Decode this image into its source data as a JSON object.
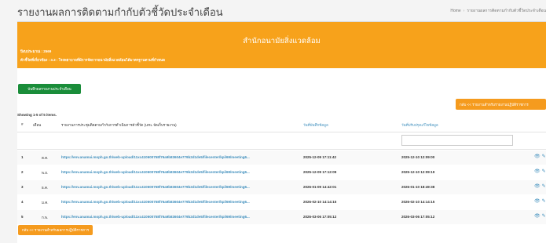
{
  "header": {
    "title": "รายงานผลการติดตามกำกับตัวชี้วัดประจำเดือน",
    "breadcrumb": [
      "Home",
      "รายงานผลการติดตามกำกับตัวชี้วัดประจำเดือน"
    ]
  },
  "banner": {
    "title": "สำนักอนามัยสิ่งแวดล้อม",
    "year_line": "ปีงบประมาณ : 2569",
    "indicator_line": "ตัวชี้วัดที่เกี่ยวข้อง : 3.3 : โรงพยาบาลที่มีการจัดการอนามัยสิ่งแวดล้อมได้มาตรฐานตามที่กำหนด",
    "color": "#f7a21b"
  },
  "buttons": {
    "add": "บันทึกผลรายงานประจำเดือน",
    "back_top": "กลับ << รายงานสำหรับรายงานปฏิบัติราชการ",
    "back_bottom": "กลับ << รายงานสำหรับผลการปฏิบัติราชการ"
  },
  "table": {
    "summary": "Showing 1-5 of 5 items.",
    "columns": [
      "#",
      "เดือน",
      "รายงานการประชุมติดตามกำกับการดำเนินการตัวชี้วัด (URL จัดเก็บรายงาน)",
      "วันที่บันทึกข้อมูล",
      "วันที่ปรับปรุงแก้ไขข้อมูล"
    ],
    "rows": [
      {
        "num": "1",
        "month": "ต.ค.",
        "url": "https://env.anamai.moph.go.th/web-upload/11xc410600758f76a9b83604e779b2d1de5/filecenter/kpi/69/meeting6...",
        "created": "2025-12-09 17:11:42",
        "updated": "2025-12-10 12:09:00"
      },
      {
        "num": "2",
        "month": "พ.ย.",
        "url": "https://env.anamai.moph.go.th/web-upload/11xc410600758f76a9b83604e779b2d1de5/filecenter/kpi/69/meeting6...",
        "created": "2025-12-09 17:12:09",
        "updated": "2025-12-10 12:09:19"
      },
      {
        "num": "3",
        "month": "ธ.ค.",
        "url": "https://env.anamai.moph.go.th/web-upload/11xc410600758f76a9b83604e779b2d1de5/filecenter/kpi/69/meeting6...",
        "created": "2026-01-09 14:42:01",
        "updated": "2026-01-10 18:49:38"
      },
      {
        "num": "4",
        "month": "ม.ค.",
        "url": "https://env.anamai.moph.go.th/web-upload/11xc410600758f76a9b83604e779b2d1de5/filecenter/kpi/69/meeting6...",
        "created": "2026-02-10 14:14:15",
        "updated": "2026-02-10 14:14:15"
      },
      {
        "num": "5",
        "month": "ก.พ.",
        "url": "https://env.anamai.moph.go.th/web-upload/11xc410600758f76a9b83604e779b2d1de5/filecenter/kpi/69/meeting6...",
        "created": "2026-03-06 17:05:12",
        "updated": "2026-03-06 17:05:12"
      }
    ],
    "action_icons": [
      "eye-icon",
      "pencil-icon",
      "trash-icon"
    ]
  }
}
